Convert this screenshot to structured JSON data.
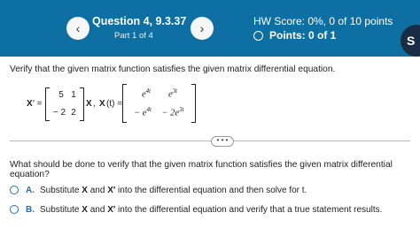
{
  "header": {
    "prev_icon": "chevron-left-icon",
    "next_icon": "chevron-right-icon",
    "prev_glyph": "‹",
    "next_glyph": "›",
    "question_title": "Question 4, 9.3.37",
    "part_label": "Part 1 of 4",
    "hw_score": "HW Score: 0%, 0 of 10 points",
    "points": "Points: 0 of 1",
    "user_initial": "S",
    "bar_color": "#0e6fa3"
  },
  "problem": {
    "instruction": "Verify that the given matrix function satisfies the given matrix differential equation.",
    "x_prime": "X",
    "prime_equals": "′ =",
    "matrix_a": [
      [
        "5",
        "1"
      ],
      [
        "− 2",
        "2"
      ]
    ],
    "x_after": "X",
    "comma": ",",
    "x_t": "X",
    "x_t_suffix": "(t) =",
    "matrix_x": [
      [
        "e^4t",
        "e^3t"
      ],
      [
        "− e^4t",
        "− 2e^3t"
      ]
    ],
    "cell_r1c1_base": "e",
    "cell_r1c1_exp": "4t",
    "cell_r1c2_base": "e",
    "cell_r1c2_exp": "3t",
    "cell_r2c1_base": "− e",
    "cell_r2c1_exp": "4t",
    "cell_r2c2_base": "− 2e",
    "cell_r2c2_exp": "3t"
  },
  "divider_label": "• • •",
  "question": "What should be done to verify that the given matrix function satisfies the given matrix differential equation?",
  "options": [
    {
      "letter": "A.",
      "pre": "Substitute ",
      "b1": "X",
      "mid": " and ",
      "b2": "X′",
      "post": " into the differential equation and then solve for t."
    },
    {
      "letter": "B.",
      "pre": "Substitute ",
      "b1": "X",
      "mid": " and ",
      "b2": "X′",
      "post": " into the differential equation and verify that a true statement results."
    }
  ]
}
